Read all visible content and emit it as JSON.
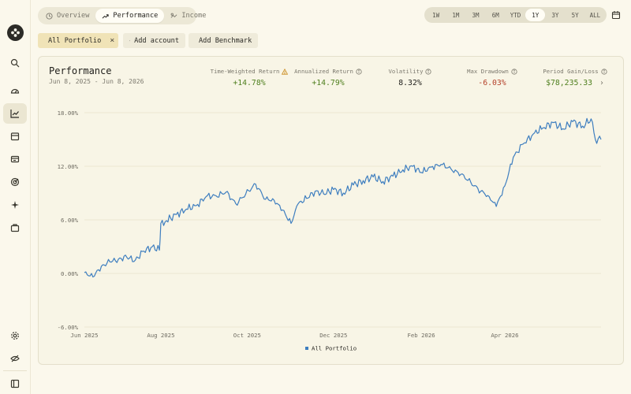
{
  "tabs": [
    {
      "label": "Overview",
      "icon": "clock-icon",
      "active": false
    },
    {
      "label": "Performance",
      "icon": "trend-icon",
      "active": true
    },
    {
      "label": "Income",
      "icon": "income-icon",
      "active": false
    }
  ],
  "ranges": [
    "1W",
    "1M",
    "3M",
    "6M",
    "YTD",
    "1Y",
    "3Y",
    "5Y",
    "ALL"
  ],
  "active_range": "1Y",
  "filters": {
    "portfolio": "All Portfolio",
    "add_account": "Add account",
    "add_benchmark": "Add Benchmark"
  },
  "card": {
    "title": "Performance",
    "subtitle": "Jun 8, 2025 - Jun 8, 2026"
  },
  "stats": {
    "twr_label": "Time-Weighted Return",
    "twr_value": "+14.78%",
    "ann_label": "Annualized Return",
    "ann_value": "+14.79%",
    "vol_label": "Volatility",
    "vol_value": "8.32%",
    "dd_label": "Max Drawdown",
    "dd_value": "-6.03%",
    "pgl_label": "Period Gain/Loss",
    "pgl_value": "$78,235.33"
  },
  "colors": {
    "positive": "#4f7f1e",
    "negative": "#b4412a",
    "warning": "#c98a1a",
    "series": "#3e7ebf"
  },
  "chart_data": {
    "type": "line",
    "title": "",
    "xlabel": "",
    "ylabel": "",
    "ylim": [
      -6,
      18
    ],
    "y_ticks": [
      18,
      12,
      6,
      0,
      -6
    ],
    "y_tick_labels": [
      "18.00%",
      "12.00%",
      "6.00%",
      "0.00%",
      "-6.00%"
    ],
    "x_ticks": [
      "2025-06-08",
      "2025-08-01",
      "2025-10-01",
      "2025-12-01",
      "2026-02-01",
      "2026-04-01"
    ],
    "x_tick_labels": [
      "Jun 2025",
      "Aug 2025",
      "Oct 2025",
      "Dec 2025",
      "Feb 2026",
      "Apr 2026"
    ],
    "xlim": [
      "2025-06-08",
      "2026-06-08"
    ],
    "legend": "bottom",
    "grid": true,
    "series": [
      {
        "name": "All Portfolio",
        "x": [
          "2025-06-08",
          "2025-06-14",
          "2025-06-20",
          "2025-06-26",
          "2025-07-02",
          "2025-07-08",
          "2025-07-14",
          "2025-07-20",
          "2025-07-26",
          "2025-07-31",
          "2025-08-01",
          "2025-08-05",
          "2025-08-12",
          "2025-08-19",
          "2025-08-26",
          "2025-09-02",
          "2025-09-09",
          "2025-09-16",
          "2025-09-23",
          "2025-09-30",
          "2025-10-07",
          "2025-10-14",
          "2025-10-20",
          "2025-10-26",
          "2025-11-01",
          "2025-11-06",
          "2025-11-12",
          "2025-11-18",
          "2025-11-24",
          "2025-12-01",
          "2025-12-08",
          "2025-12-15",
          "2025-12-22",
          "2025-12-29",
          "2026-01-05",
          "2026-01-12",
          "2026-01-19",
          "2026-01-26",
          "2026-02-01",
          "2026-02-08",
          "2026-02-15",
          "2026-02-22",
          "2026-03-01",
          "2026-03-08",
          "2026-03-15",
          "2026-03-21",
          "2026-03-26",
          "2026-04-01",
          "2026-04-07",
          "2026-04-14",
          "2026-04-21",
          "2026-04-28",
          "2026-05-05",
          "2026-05-12",
          "2026-05-19",
          "2026-05-26",
          "2026-06-01",
          "2026-06-04",
          "2026-06-08"
        ],
        "y": [
          0.1,
          -0.4,
          0.8,
          1.3,
          1.6,
          1.8,
          1.5,
          2.5,
          3.0,
          2.6,
          5.6,
          5.9,
          6.6,
          7.2,
          7.6,
          8.6,
          8.7,
          9.1,
          7.8,
          8.9,
          10.0,
          8.3,
          8.2,
          7.1,
          5.6,
          7.8,
          8.4,
          9.2,
          8.9,
          9.4,
          9.0,
          9.9,
          10.4,
          10.8,
          10.3,
          10.9,
          11.6,
          12.0,
          11.3,
          11.9,
          12.2,
          11.7,
          11.1,
          10.2,
          9.2,
          8.6,
          7.5,
          9.8,
          13.0,
          14.5,
          15.6,
          16.3,
          16.9,
          16.2,
          17.0,
          16.5,
          17.3,
          15.0,
          15.0
        ]
      }
    ]
  }
}
